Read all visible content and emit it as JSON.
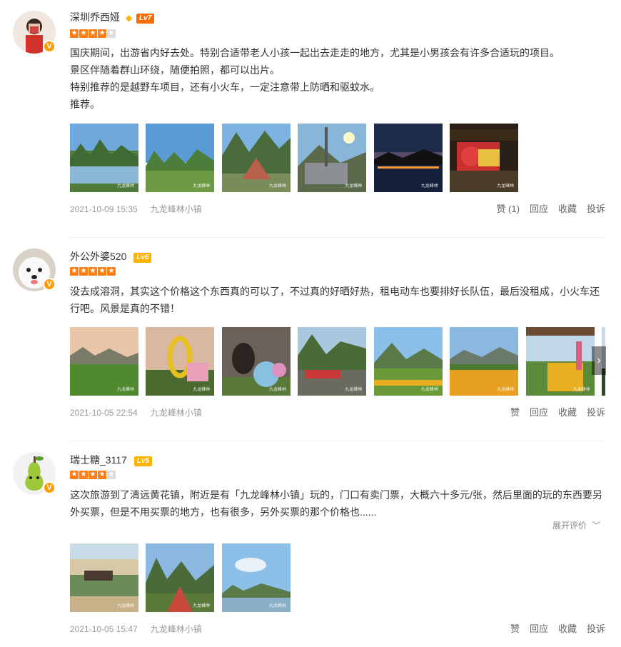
{
  "reviews": [
    {
      "user": "深圳乔西娅",
      "level": "Lv7",
      "level_color": "#ff6a00",
      "rating": 4,
      "lines": [
        "国庆期间，出游省内好去处。特别合适带老人小孩一起出去走走的地方，尤其是小男孩会有许多合适玩的项目。",
        "景区伴随着群山环绕，随便拍照，都可以出片。",
        "特别推荐的是越野车项目，还有小火车，一定注意带上防晒和驱蚊水。",
        "推荐。"
      ],
      "date": "2021-10-09 15:35",
      "place": "九龙峰林小镇",
      "actions": {
        "like": "赞 (1)",
        "reply": "回应",
        "fav": "收藏",
        "report": "投诉"
      }
    },
    {
      "user": "外公外婆520",
      "level": "Lv6",
      "level_color": "#ffb300",
      "rating": 5,
      "lines": [
        "没去成溶洞，其实这个价格这个东西真的可以了，不过真的好晒好热，租电动车也要排好长队伍，最后没租成，小火车还",
        "行吧。风景是真的不错！"
      ],
      "date": "2021-10-05 22:54",
      "place": "九龙峰林小镇",
      "actions": {
        "like": "赞",
        "reply": "回应",
        "fav": "收藏",
        "report": "投诉"
      }
    },
    {
      "user": "瑞士糖_3117",
      "level": "Lv5",
      "level_color": "#ffb300",
      "rating": 4,
      "lines": [
        "这次旅游到了清远黄花镇，附近是有「九龙峰林小镇」玩的，门口有卖门票，大概六十多元/张，然后里面的玩的东西要另",
        "外买票，但是不用买票的地方，也有很多，另外买票的那个价格也......"
      ],
      "expand": "展开评价",
      "date": "2021-10-05 15:47",
      "place": "九龙峰林小镇",
      "actions": {
        "like": "赞",
        "reply": "回应",
        "fav": "收藏",
        "report": "投诉"
      }
    }
  ],
  "vip_badge": "V",
  "photo_watermark": "九龙峰林",
  "carousel_next": "›",
  "colors": {
    "star": "#ff7d13",
    "vip": "#ff9a00",
    "divider": "#eeeeee"
  }
}
